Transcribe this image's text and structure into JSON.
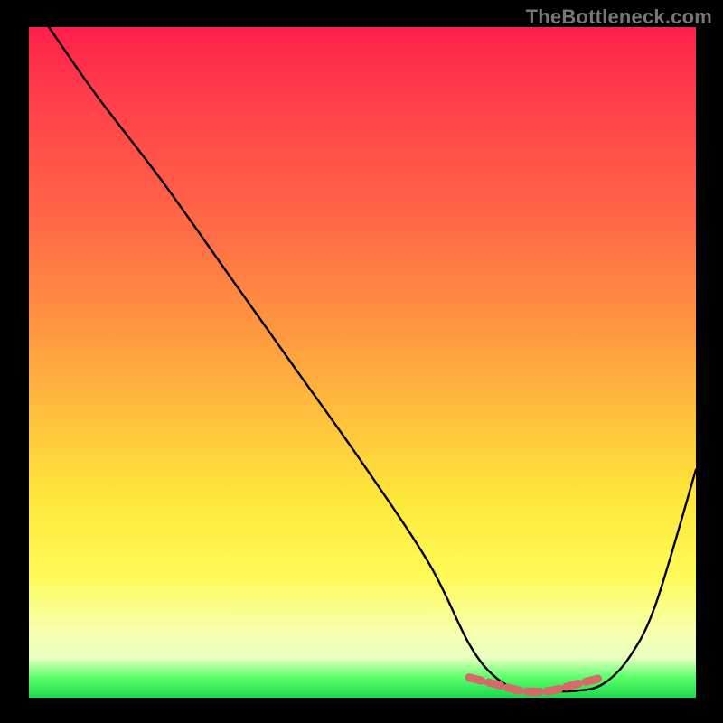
{
  "watermark": "TheBottleneck.com",
  "chart_data": {
    "type": "line",
    "title": "",
    "xlabel": "",
    "ylabel": "",
    "xlim": [
      0,
      100
    ],
    "ylim": [
      0,
      100
    ],
    "grid": false,
    "legend": false,
    "series": [
      {
        "name": "bottleneck-curve",
        "x": [
          3,
          10,
          20,
          30,
          40,
          50,
          60,
          66,
          70,
          74,
          78,
          82,
          86,
          90,
          94,
          100
        ],
        "y": [
          100,
          90,
          77,
          63,
          49,
          35,
          20,
          8,
          3,
          1,
          1,
          1,
          2,
          6,
          14,
          34
        ]
      },
      {
        "name": "marker-band",
        "x": [
          66,
          70,
          74,
          78,
          82,
          86
        ],
        "y": [
          3,
          2,
          1,
          1,
          2,
          3
        ]
      }
    ],
    "colors": {
      "curve": "#000000",
      "marker": "#d46a6a",
      "gradient_top": "#ff1f4a",
      "gradient_mid": "#ffe63a",
      "gradient_bottom": "#1fd84b"
    }
  }
}
